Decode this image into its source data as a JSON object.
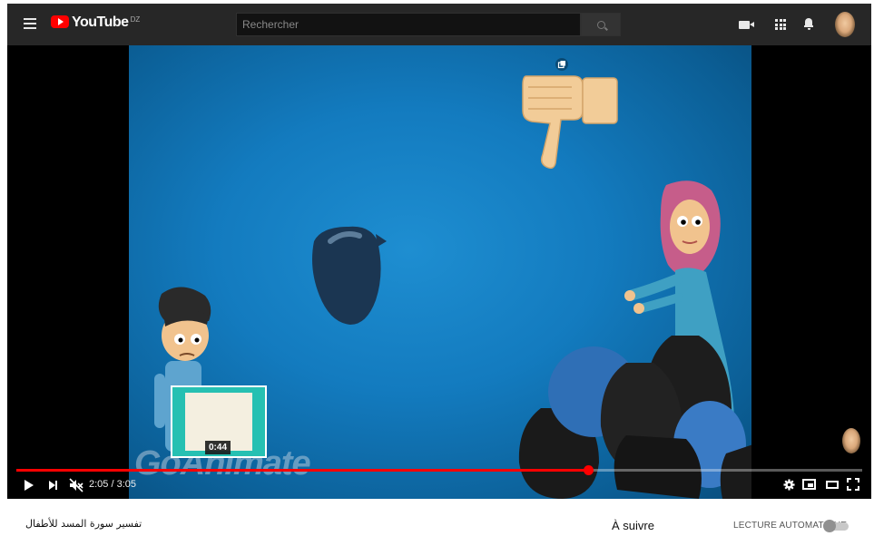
{
  "header": {
    "logo_text": "YouTube",
    "country_code": "DZ",
    "search_placeholder": "Rechercher",
    "icons": [
      "menu-icon",
      "search-icon",
      "video-camera-icon",
      "apps-grid-icon",
      "bell-icon",
      "avatar"
    ]
  },
  "player": {
    "watermark": "GoAnimate",
    "preview_time": "0:44",
    "current_time": "2:05",
    "duration": "3:05",
    "time_display": "2:05 / 3:05",
    "progress_fraction": 0.676,
    "muted": true
  },
  "below": {
    "video_title": "تفسير سورة المسد للأطفال",
    "up_next_label": "À suivre",
    "autoplay_label": "LECTURE AUTOMATIQUE",
    "autoplay_on": false
  },
  "colors": {
    "topbar": "#272727",
    "accent_red": "#ff0000",
    "video_blue": "#1e8ed1"
  }
}
